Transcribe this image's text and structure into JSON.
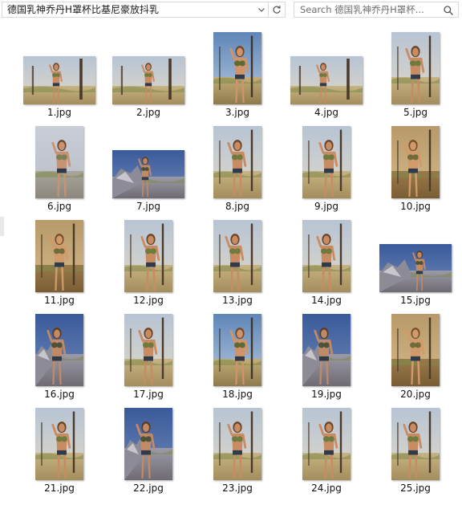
{
  "address_bar": {
    "path": "德国乳神乔丹H罩杯比基尼豪放抖乳",
    "dropdown_icon": "chevron-down-icon",
    "refresh_icon": "refresh-icon"
  },
  "search_box": {
    "placeholder": "Search 德国乳神乔丹H罩杯...",
    "icon": "search-icon"
  },
  "files": [
    {
      "name": "1.jpg",
      "orientation": "landscape",
      "palette": "desert"
    },
    {
      "name": "2.jpg",
      "orientation": "landscape",
      "palette": "desert"
    },
    {
      "name": "3.jpg",
      "orientation": "portrait",
      "palette": "bluesky"
    },
    {
      "name": "4.jpg",
      "orientation": "landscape",
      "palette": "desert"
    },
    {
      "name": "5.jpg",
      "orientation": "portrait",
      "palette": "desert"
    },
    {
      "name": "6.jpg",
      "orientation": "portrait",
      "palette": "haze"
    },
    {
      "name": "7.jpg",
      "orientation": "landscape",
      "palette": "rocks"
    },
    {
      "name": "8.jpg",
      "orientation": "portrait",
      "palette": "desert"
    },
    {
      "name": "9.jpg",
      "orientation": "portrait",
      "palette": "desert"
    },
    {
      "name": "10.jpg",
      "orientation": "portrait",
      "palette": "warm"
    },
    {
      "name": "11.jpg",
      "orientation": "portrait",
      "palette": "warm"
    },
    {
      "name": "12.jpg",
      "orientation": "portrait",
      "palette": "desert"
    },
    {
      "name": "13.jpg",
      "orientation": "portrait",
      "palette": "desert"
    },
    {
      "name": "14.jpg",
      "orientation": "portrait",
      "palette": "desert"
    },
    {
      "name": "15.jpg",
      "orientation": "landscape",
      "palette": "rocks"
    },
    {
      "name": "16.jpg",
      "orientation": "portrait",
      "palette": "rocks"
    },
    {
      "name": "17.jpg",
      "orientation": "portrait",
      "palette": "desert"
    },
    {
      "name": "18.jpg",
      "orientation": "portrait",
      "palette": "bluesky"
    },
    {
      "name": "19.jpg",
      "orientation": "portrait",
      "palette": "rocks"
    },
    {
      "name": "20.jpg",
      "orientation": "portrait",
      "palette": "warm"
    },
    {
      "name": "21.jpg",
      "orientation": "portrait",
      "palette": "desert"
    },
    {
      "name": "22.jpg",
      "orientation": "portrait",
      "palette": "rocks"
    },
    {
      "name": "23.jpg",
      "orientation": "portrait",
      "palette": "desert"
    },
    {
      "name": "24.jpg",
      "orientation": "portrait",
      "palette": "desert"
    },
    {
      "name": "25.jpg",
      "orientation": "portrait",
      "palette": "desert"
    }
  ]
}
